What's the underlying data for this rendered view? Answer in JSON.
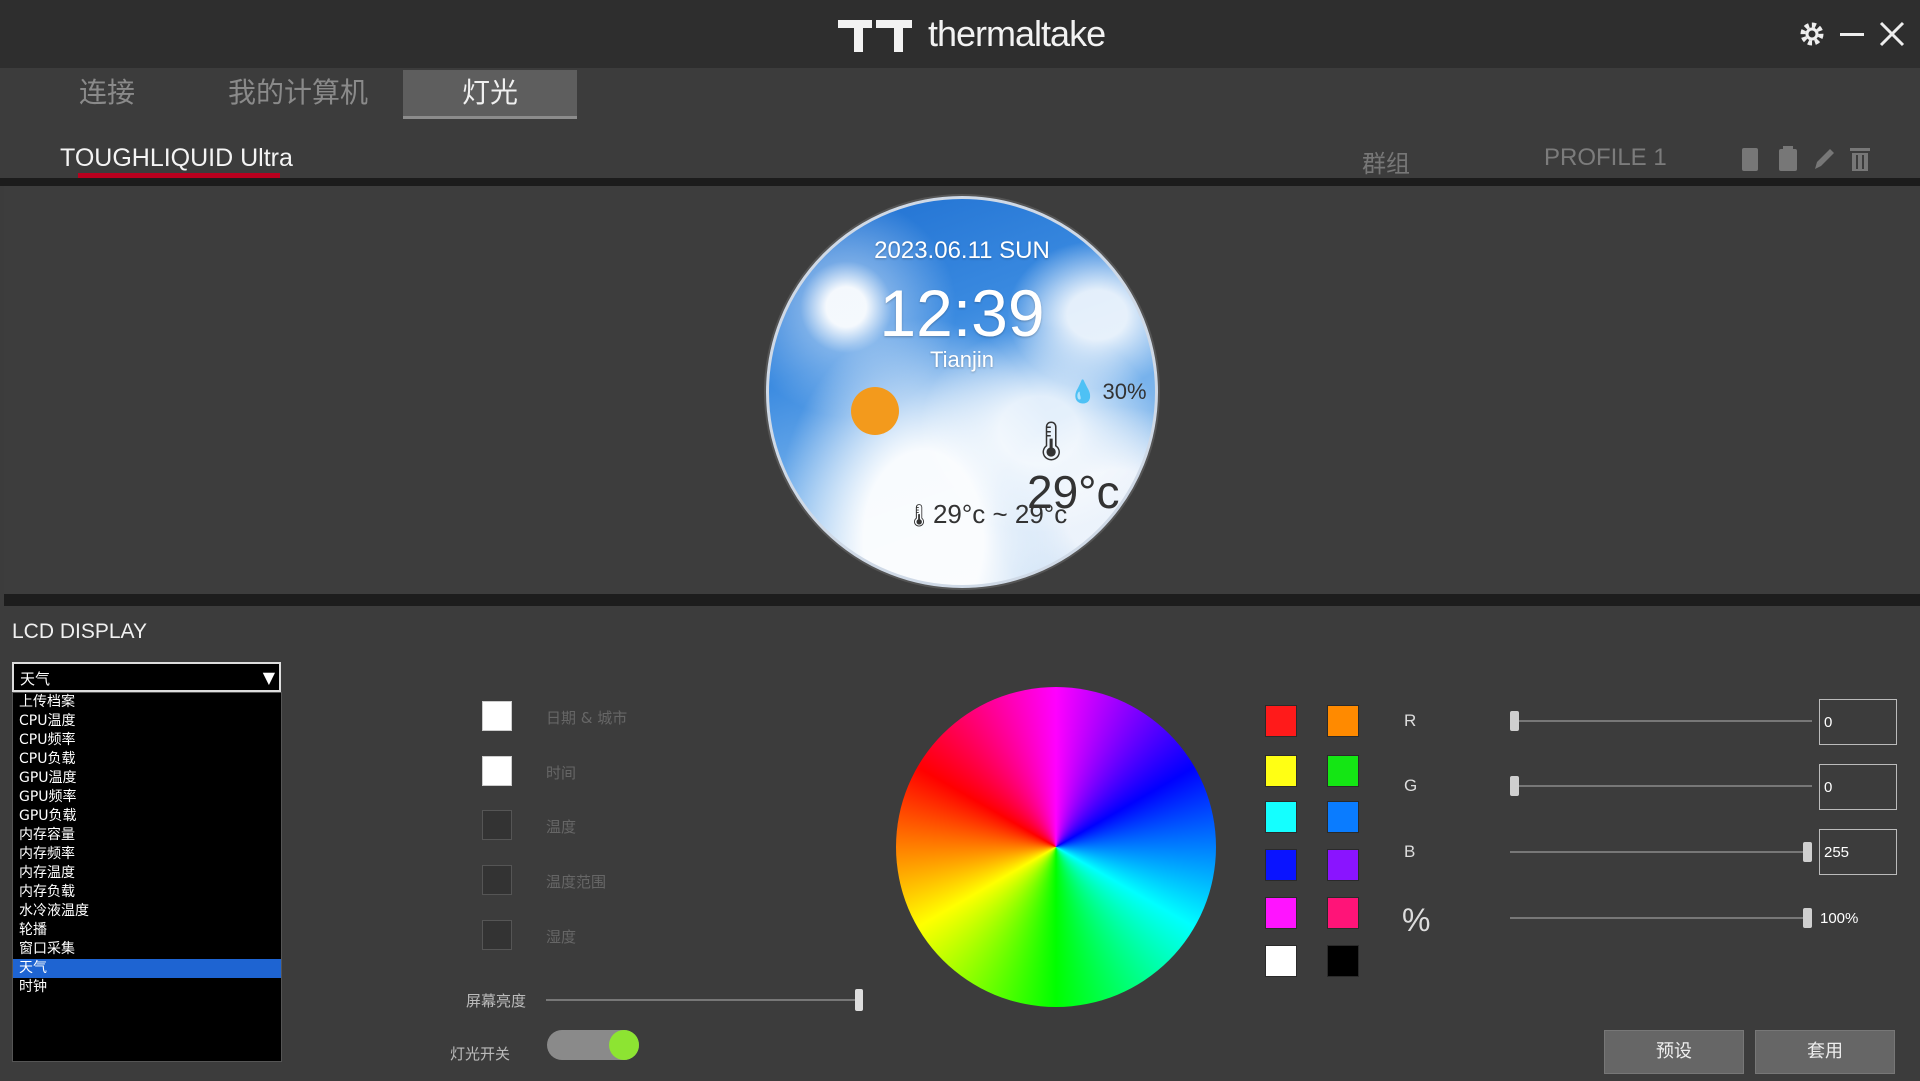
{
  "app": {
    "brand": "thermaltake"
  },
  "nav": {
    "tabs": [
      "连接",
      "我的计算机",
      "灯光"
    ],
    "active_index": 2
  },
  "device": {
    "name": "TOUGHLIQUID Ultra",
    "group_label": "群组",
    "profile_label": "PROFILE 1"
  },
  "lcd_preview": {
    "date": "2023.06.11 SUN",
    "time": "12:39",
    "city": "Tianjin",
    "humidity": "30%",
    "temperature": "29°c",
    "temp_range": "29°c ~ 29°c"
  },
  "lcd_panel": {
    "title": "LCD DISPLAY",
    "selected": "天气",
    "options": [
      "上传档案",
      "CPU温度",
      "CPU频率",
      "CPU负载",
      "GPU温度",
      "GPU频率",
      "GPU负载",
      "内存容量",
      "内存频率",
      "内存温度",
      "内存负载",
      "水冷液温度",
      "轮播",
      "窗口采集",
      "天气",
      "时钟"
    ],
    "selected_index": 14
  },
  "display_options": [
    {
      "label": "日期 & 城市",
      "checked": true
    },
    {
      "label": "时间",
      "checked": true
    },
    {
      "label": "温度",
      "checked": false
    },
    {
      "label": "温度范围",
      "checked": false
    },
    {
      "label": "湿度",
      "checked": false
    }
  ],
  "brightness": {
    "label": "屏幕亮度",
    "level": 1.0
  },
  "light_switch": {
    "label": "灯光开关",
    "on": true
  },
  "swatches": [
    [
      "#ff1a1a",
      "#ff8a00"
    ],
    [
      "#ffff14",
      "#14e614"
    ],
    [
      "#14ffff",
      "#0a7cff"
    ],
    [
      "#0a14ff",
      "#8a14ff"
    ],
    [
      "#ff14ff",
      "#ff1478"
    ],
    [
      "#ffffff",
      "#000000"
    ]
  ],
  "rgb": {
    "r": {
      "label": "R",
      "value": "0",
      "level": 0.0
    },
    "g": {
      "label": "G",
      "value": "0",
      "level": 0.0
    },
    "b": {
      "label": "B",
      "value": "255",
      "level": 1.0
    },
    "percent": {
      "label": "%",
      "value": "100%",
      "level": 1.0
    }
  },
  "buttons": {
    "preset": "预设",
    "apply": "套用"
  }
}
